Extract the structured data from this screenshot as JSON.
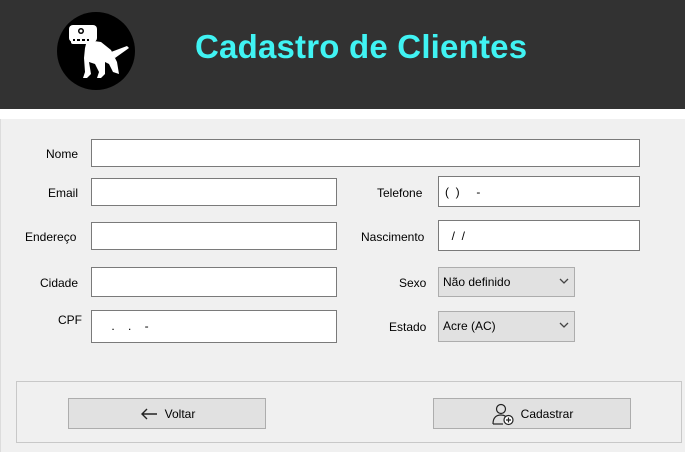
{
  "header": {
    "title": "Cadastro de Clientes",
    "logo_icon": "dinosaur-icon",
    "background": "#323232",
    "title_color": "#40f3f3"
  },
  "form": {
    "nome": {
      "label": "Nome",
      "value": ""
    },
    "email": {
      "label": "Email",
      "value": ""
    },
    "telefone": {
      "label": "Telefone",
      "value": "(  )     -"
    },
    "endereco": {
      "label": "Endereço",
      "value": ""
    },
    "nascimento": {
      "label": "Nascimento",
      "value": "  /  /"
    },
    "cidade": {
      "label": "Cidade",
      "value": ""
    },
    "sexo": {
      "label": "Sexo",
      "value": "Não definido"
    },
    "cpf": {
      "label": "CPF",
      "value": "    .    .    -"
    },
    "estado": {
      "label": "Estado",
      "value": "Acre (AC)"
    }
  },
  "buttons": {
    "voltar": {
      "label": "Voltar",
      "icon": "arrow-left-icon"
    },
    "cadastrar": {
      "label": "Cadastrar",
      "icon": "add-user-icon"
    }
  }
}
